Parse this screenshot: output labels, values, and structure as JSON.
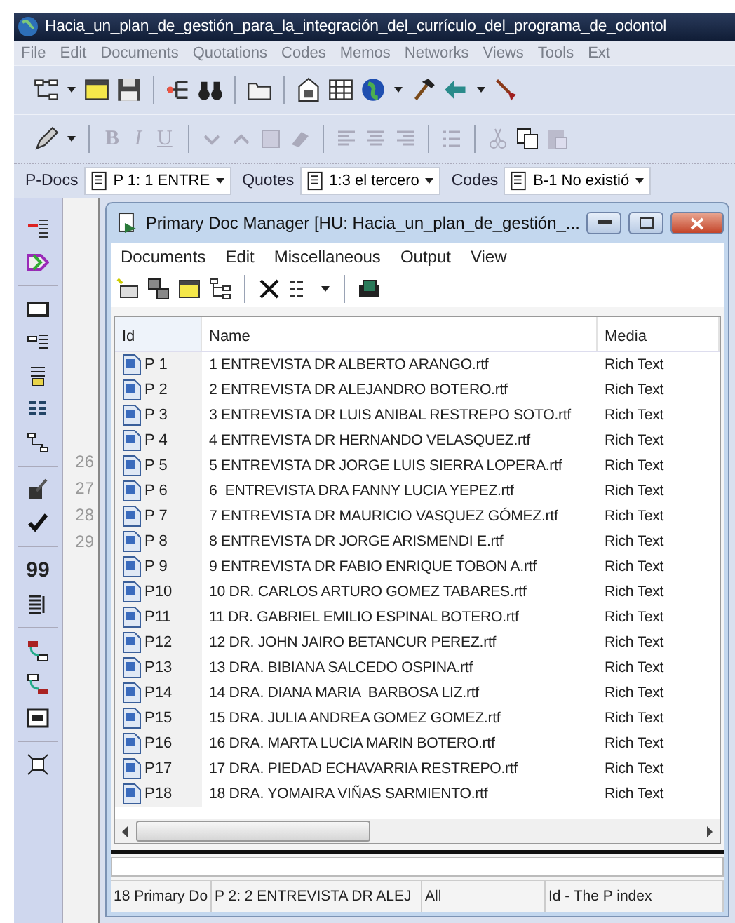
{
  "window": {
    "title": "Hacia_un_plan_de_gestión_para_la_integración_del_currículo_del_programa_de_odontol"
  },
  "menu": [
    "File",
    "Edit",
    "Documents",
    "Quotations",
    "Codes",
    "Memos",
    "Networks",
    "Views",
    "Tools",
    "Ext"
  ],
  "format_buttons": [
    {
      "label": "B",
      "kind": "bold"
    },
    {
      "label": "I",
      "kind": "italic"
    },
    {
      "label": "U",
      "kind": "underline"
    }
  ],
  "selectors": [
    {
      "label": "P-Docs",
      "value": "P 1: 1 ENTRE"
    },
    {
      "label": "Quotes",
      "value": "1:3 el tercero"
    },
    {
      "label": "Codes",
      "value": "B-1 No existió"
    }
  ],
  "side_toolbar": {
    "quote_button": "99"
  },
  "line_numbers": [
    "26",
    "27",
    "28",
    "29"
  ],
  "manager": {
    "title": "Primary Doc Manager [HU: Hacia_un_plan_de_gestión_...",
    "menu": [
      "Documents",
      "Edit",
      "Miscellaneous",
      "Output",
      "View"
    ],
    "columns": [
      "Id",
      "Name",
      "Media"
    ],
    "rows": [
      {
        "id": "P 1",
        "name": "1 ENTREVISTA DR ALBERTO ARANGO.rtf",
        "media": "Rich Text"
      },
      {
        "id": "P 2",
        "name": "2 ENTREVISTA DR ALEJANDRO BOTERO.rtf",
        "media": "Rich Text"
      },
      {
        "id": "P 3",
        "name": "3 ENTREVISTA DR LUIS ANIBAL RESTREPO SOTO.rtf",
        "media": "Rich Text"
      },
      {
        "id": "P 4",
        "name": "4 ENTREVISTA DR HERNANDO VELASQUEZ.rtf",
        "media": "Rich Text"
      },
      {
        "id": "P 5",
        "name": "5 ENTREVISTA DR JORGE LUIS SIERRA LOPERA.rtf",
        "media": "Rich Text"
      },
      {
        "id": "P 6",
        "name": "6  ENTREVISTA DRA FANNY LUCIA YEPEZ.rtf",
        "media": "Rich Text"
      },
      {
        "id": "P 7",
        "name": "7 ENTREVISTA DR MAURICIO VASQUEZ GÓMEZ.rtf",
        "media": "Rich Text"
      },
      {
        "id": "P 8",
        "name": "8 ENTREVISTA DR JORGE ARISMENDI E.rtf",
        "media": "Rich Text"
      },
      {
        "id": "P 9",
        "name": "9 ENTREVISTA DR FABIO ENRIQUE TOBON A.rtf",
        "media": "Rich Text"
      },
      {
        "id": "P10",
        "name": "10 DR. CARLOS ARTURO GOMEZ TABARES.rtf",
        "media": "Rich Text"
      },
      {
        "id": "P11",
        "name": "11 DR. GABRIEL EMILIO ESPINAL BOTERO.rtf",
        "media": "Rich Text"
      },
      {
        "id": "P12",
        "name": "12 DR. JOHN JAIRO BETANCUR PEREZ.rtf",
        "media": "Rich Text"
      },
      {
        "id": "P13",
        "name": "13 DRA. BIBIANA SALCEDO OSPINA.rtf",
        "media": "Rich Text"
      },
      {
        "id": "P14",
        "name": "14 DRA. DIANA MARIA  BARBOSA LIZ.rtf",
        "media": "Rich Text"
      },
      {
        "id": "P15",
        "name": "15 DRA. JULIA ANDREA GOMEZ GOMEZ.rtf",
        "media": "Rich Text"
      },
      {
        "id": "P16",
        "name": "16 DRA. MARTA LUCIA MARIN BOTERO.rtf",
        "media": "Rich Text"
      },
      {
        "id": "P17",
        "name": "17 DRA. PIEDAD ECHAVARRIA RESTREPO.rtf",
        "media": "Rich Text"
      },
      {
        "id": "P18",
        "name": "18 DRA. YOMAIRA VIÑAS SARMIENTO.rtf",
        "media": "Rich Text"
      }
    ],
    "status_bar": [
      "18 Primary Do",
      "P 2: 2 ENTREVISTA DR ALEJ",
      "All",
      "Id - The P index"
    ]
  }
}
